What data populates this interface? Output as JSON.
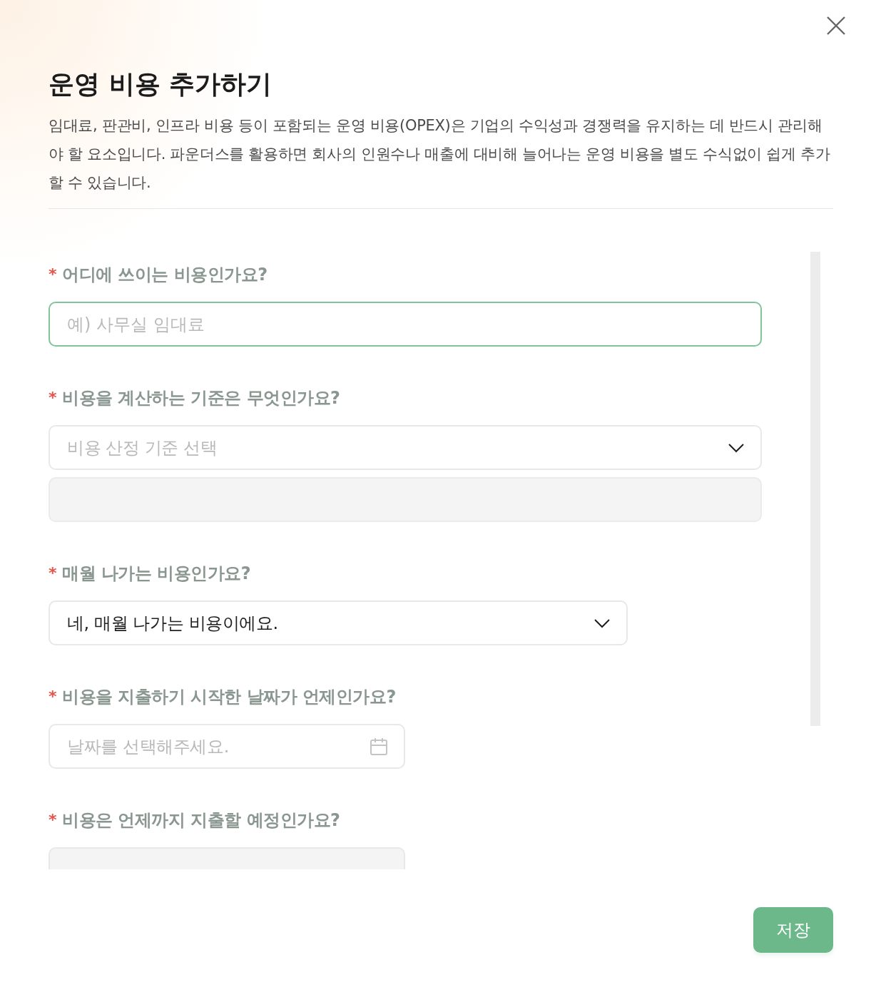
{
  "dialog": {
    "title": "운영 비용 추가하기",
    "description": "임대료, 판관비, 인프라 비용 등이 포함되는 운영 비용(OPEX)은 기업의 수익성과 경쟁력을 유지하는 데 반드시 관리해야 할 요소입니다. 파운더스를 활용하면 회사의 인원수나 매출에 대비해 늘어나는 운영 비용을 별도 수식없이 쉽게 추가할 수 있습니다."
  },
  "fields": [
    {
      "label": "어디에 쓰이는 비용인가요?",
      "required_mark": "*",
      "kind": "text",
      "placeholder": "예) 사무실 임대료",
      "focused": true,
      "disabled": false
    },
    {
      "label": "비용을 계산하는 기준은 무엇인가요?",
      "required_mark": "*",
      "kind": "select",
      "placeholder": "비용 산정 기준 선택",
      "focused": false,
      "disabled": false,
      "detail_box": true
    },
    {
      "label": "매월 나가는 비용인가요?",
      "required_mark": "*",
      "kind": "short_select",
      "value": "네, 매월 나가는 비용이에요.",
      "focused": false,
      "disabled": false
    },
    {
      "label": "비용을 지출하기 시작한 날짜가 언제인가요?",
      "required_mark": "*",
      "kind": "date",
      "placeholder": "날짜를 선택해주세요.",
      "focused": false,
      "disabled": false
    },
    {
      "label": "비용은 언제까지 지출할 예정인가요?",
      "required_mark": "*",
      "kind": "date",
      "focused": false,
      "disabled": true
    }
  ],
  "save_button": "저장"
}
